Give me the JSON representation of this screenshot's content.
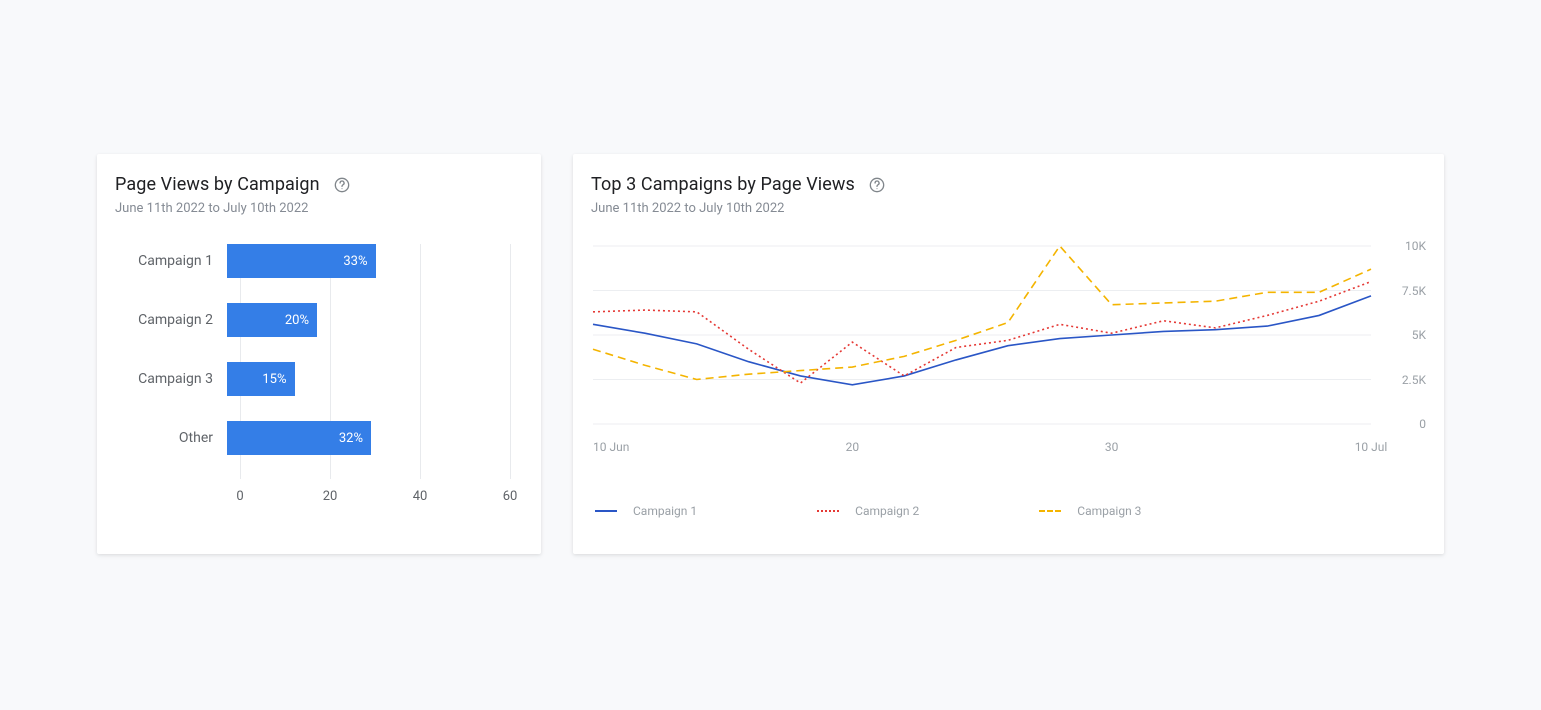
{
  "bar_card": {
    "title": "Page Views by Campaign",
    "subtitle": "June 11th 2022 to July 10th 2022"
  },
  "line_card": {
    "title": "Top 3 Campaigns by Page Views",
    "subtitle": "June 11th 2022 to July 10th 2022"
  },
  "chart_data": [
    {
      "type": "bar",
      "title": "Page Views by Campaign",
      "orientation": "horizontal",
      "categories": [
        "Campaign 1",
        "Campaign 2",
        "Campaign 3",
        "Other"
      ],
      "values": [
        33,
        20,
        15,
        32
      ],
      "value_suffix": "%",
      "x_ticks": [
        0,
        20,
        40,
        60
      ],
      "xlim": [
        0,
        60
      ],
      "bar_color": "#347ee7"
    },
    {
      "type": "line",
      "title": "Top 3 Campaigns by Page Views",
      "x": [
        10,
        12,
        14,
        16,
        18,
        20,
        22,
        24,
        26,
        28,
        30,
        2,
        4,
        6,
        8,
        10
      ],
      "x_ticks": [
        "10 Jun",
        "20",
        "30",
        "10 Jul"
      ],
      "ylim": [
        0,
        10000
      ],
      "y_ticks": [
        "0",
        "2.5K",
        "5K",
        "7.5K",
        "10K"
      ],
      "series": [
        {
          "name": "Campaign 1",
          "color": "#2a56c6",
          "style": "solid",
          "values": [
            5600,
            5100,
            4500,
            3500,
            2700,
            2200,
            2700,
            3600,
            4400,
            4800,
            5000,
            5200,
            5300,
            5500,
            6100,
            7200
          ]
        },
        {
          "name": "Campaign 2",
          "color": "#e53935",
          "style": "dotted",
          "values": [
            6300,
            6400,
            6300,
            4200,
            2300,
            4600,
            2700,
            4300,
            4700,
            5600,
            5100,
            5800,
            5400,
            6100,
            6900,
            8000
          ]
        },
        {
          "name": "Campaign 3",
          "color": "#f4b400",
          "style": "dashed",
          "values": [
            4200,
            3300,
            2500,
            2800,
            3000,
            3200,
            3800,
            4700,
            5700,
            10000,
            6700,
            6800,
            6900,
            7400,
            7400,
            8700
          ]
        }
      ],
      "legend_position": "bottom"
    }
  ]
}
